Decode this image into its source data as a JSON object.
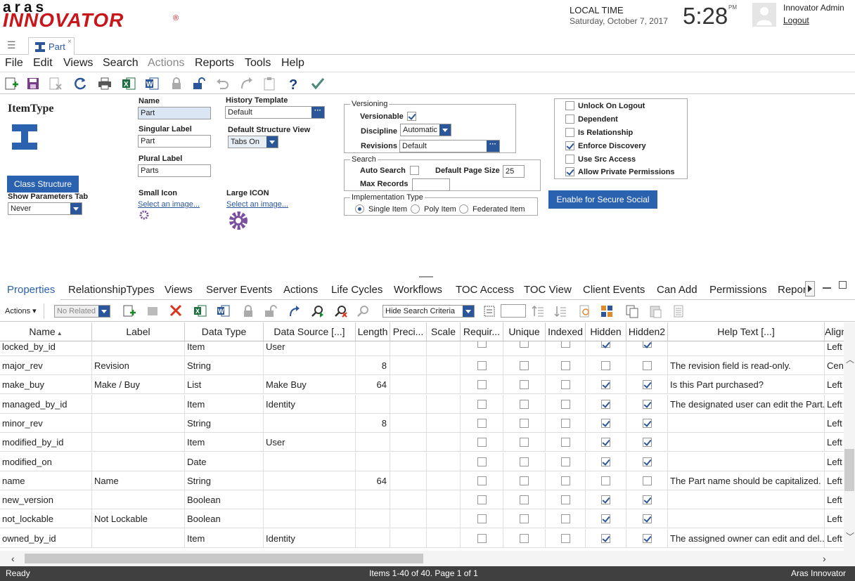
{
  "header": {
    "logo_top": "aras",
    "logo_main": "INNOVATOR",
    "logo_reg": "®",
    "local_time_label": "LOCAL TIME",
    "date": "Saturday, October 7, 2017",
    "time": "5:28",
    "time_suffix": "PM",
    "user_name": "Innovator Admin",
    "logout": "Logout"
  },
  "tabs": {
    "doc_tab": "Part",
    "close": "×"
  },
  "menu": [
    "File",
    "Edit",
    "Views",
    "Search",
    "Actions",
    "Reports",
    "Tools",
    "Help"
  ],
  "form": {
    "itemtype_heading": "ItemType",
    "name_label": "Name",
    "name_value": "Part",
    "singular_label": "Singular Label",
    "singular_value": "Part",
    "plural_label": "Plural Label",
    "plural_value": "Parts",
    "history_label": "History Template",
    "history_value": "Default",
    "structure_label": "Default Structure View",
    "structure_value": "Tabs On",
    "class_structure_btn": "Class Structure",
    "show_params_label": "Show Parameters Tab",
    "show_params_value": "Never",
    "small_icon_label": "Small Icon",
    "large_icon_label": "Large ICON",
    "select_image": "Select an image...",
    "ellipsis": "···",
    "versioning": {
      "title": "Versioning",
      "versionable": "Versionable",
      "discipline": "Discipline",
      "discipline_value": "Automatic",
      "revisions": "Revisions",
      "revisions_value": "Default"
    },
    "search": {
      "title": "Search",
      "auto_search": "Auto Search",
      "page_size_label": "Default Page Size",
      "page_size_value": "25",
      "max_records": "Max Records"
    },
    "impl": {
      "title": "Implementation Type",
      "single": "Single Item",
      "poly": "Poly Item",
      "federated": "Federated Item"
    },
    "flags": [
      {
        "label": "Unlock On Logout",
        "checked": false
      },
      {
        "label": "Dependent",
        "checked": false
      },
      {
        "label": "Is Relationship",
        "checked": false
      },
      {
        "label": "Enforce Discovery",
        "checked": true
      },
      {
        "label": "Use Src Access",
        "checked": false
      },
      {
        "label": "Allow Private Permissions",
        "checked": true
      }
    ],
    "secure_social_btn": "Enable for Secure Social"
  },
  "relationship_tabs": [
    "Properties",
    "RelationshipTypes",
    "Views",
    "Server Events",
    "Actions",
    "Life Cycles",
    "Workflows",
    "TOC Access",
    "TOC View",
    "Client Events",
    "Can Add",
    "Permissions",
    "Repor"
  ],
  "grid_toolbar": {
    "actions": "Actions",
    "no_related": "No Related",
    "hide_search": "Hide Search Criteria"
  },
  "grid": {
    "columns": [
      "Name",
      "Label",
      "Data Type",
      "Data Source [...]",
      "Length",
      "Preci...",
      "Scale",
      "Requir...",
      "Unique",
      "Indexed",
      "Hidden",
      "Hidden2",
      "Help Text [...]",
      "Alignm"
    ],
    "sort_indicator": "▲",
    "rows": [
      {
        "name": "locked_by_id",
        "label": "",
        "type": "Item",
        "source": "User",
        "length": "",
        "hidden": true,
        "hidden2": true,
        "help": "",
        "align": "Left"
      },
      {
        "name": "major_rev",
        "label": "Revision",
        "type": "String",
        "source": "",
        "length": "8",
        "hidden": false,
        "hidden2": false,
        "help": "The revision field is read-only.",
        "align": "Cen"
      },
      {
        "name": "make_buy",
        "label": "Make / Buy",
        "type": "List",
        "source": "Make Buy",
        "length": "64",
        "hidden": true,
        "hidden2": true,
        "help": "Is this Part purchased?",
        "align": "Left"
      },
      {
        "name": "managed_by_id",
        "label": "",
        "type": "Item",
        "source": "Identity",
        "length": "",
        "hidden": true,
        "hidden2": true,
        "help": "The designated user can edit the Part.",
        "align": "Left"
      },
      {
        "name": "minor_rev",
        "label": "",
        "type": "String",
        "source": "",
        "length": "8",
        "hidden": true,
        "hidden2": true,
        "help": "",
        "align": "Left"
      },
      {
        "name": "modified_by_id",
        "label": "",
        "type": "Item",
        "source": "User",
        "length": "",
        "hidden": true,
        "hidden2": true,
        "help": "",
        "align": "Left"
      },
      {
        "name": "modified_on",
        "label": "",
        "type": "Date",
        "source": "",
        "length": "",
        "hidden": true,
        "hidden2": true,
        "help": "",
        "align": "Left"
      },
      {
        "name": "name",
        "label": "Name",
        "type": "String",
        "source": "",
        "length": "64",
        "hidden": false,
        "hidden2": false,
        "help": "The Part name should be capitalized.",
        "align": "Left"
      },
      {
        "name": "new_version",
        "label": "",
        "type": "Boolean",
        "source": "",
        "length": "",
        "hidden": true,
        "hidden2": true,
        "help": "",
        "align": "Left"
      },
      {
        "name": "not_lockable",
        "label": "Not Lockable",
        "type": "Boolean",
        "source": "",
        "length": "",
        "hidden": true,
        "hidden2": true,
        "help": "",
        "align": "Left"
      },
      {
        "name": "owned_by_id",
        "label": "",
        "type": "Item",
        "source": "Identity",
        "length": "",
        "hidden": true,
        "hidden2": true,
        "help": "The assigned owner can edit and del...",
        "align": "Left"
      }
    ]
  },
  "status": {
    "left": "Ready",
    "center": "Items 1-40 of 40. Page 1 of 1",
    "right": "Aras Innovator"
  },
  "colors": {
    "brand_red": "#c8161d",
    "accent_blue": "#2b62b0",
    "status_bar": "#404040"
  }
}
